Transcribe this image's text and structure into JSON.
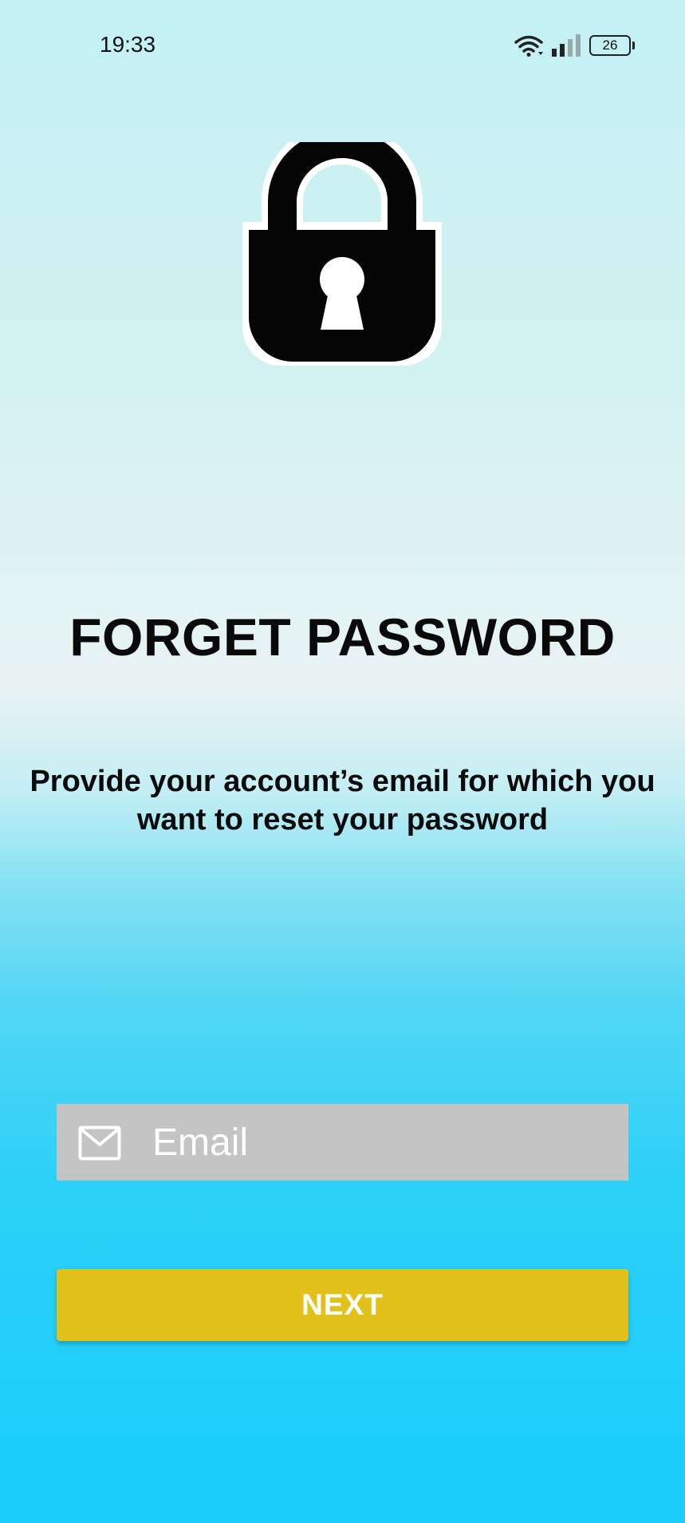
{
  "status_bar": {
    "time": "19:33",
    "battery": "26",
    "icons": [
      "wifi-icon",
      "signal-icon",
      "battery-icon"
    ]
  },
  "header_icon": "lock-icon",
  "title": "FORGET PASSWORD",
  "subtitle": "Provide your account’s email for which you want to reset your password",
  "email": {
    "placeholder": "Email",
    "value": "",
    "icon": "mail-icon"
  },
  "next_button": {
    "label": "NEXT"
  },
  "colors": {
    "button": "#e2c21a",
    "input_background": "#c4c4c4",
    "gradient_top": "#c4f1f4",
    "gradient_bottom": "#1acdfb"
  }
}
